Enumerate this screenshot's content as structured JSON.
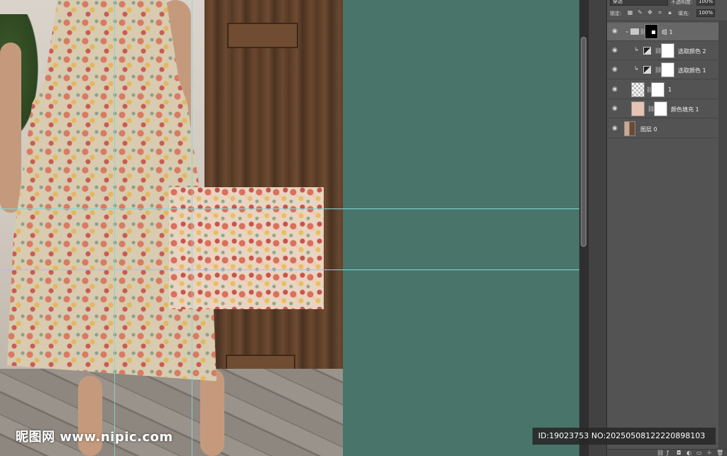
{
  "canvas": {
    "background_color": "#487469",
    "guide_color": "#7fd8d8",
    "watermark_left": "昵图网 www.nipic.com"
  },
  "layers_panel": {
    "blend_mode": "穿透",
    "opacity_label": "不透明度:",
    "opacity_value": "100%",
    "lock_label": "锁定:",
    "fill_label": "填充:",
    "fill_value": "100%",
    "layers": [
      {
        "name": "组 1",
        "type": "group",
        "selected": true,
        "thumb": "black"
      },
      {
        "name": "选取颜色 2",
        "type": "adjustment",
        "clipped": true,
        "thumb": "white"
      },
      {
        "name": "选取颜色 1",
        "type": "adjustment",
        "clipped": true,
        "thumb": "white"
      },
      {
        "name": "1",
        "type": "pattern",
        "thumb": "checker"
      },
      {
        "name": "颜色填充 1",
        "type": "fill",
        "thumb": "peach"
      },
      {
        "name": "图层 0",
        "type": "pixel",
        "thumb": "photo"
      }
    ]
  },
  "id_watermark": "ID:19023753 NO:20250508122220898103",
  "icons": {
    "eye": "eye-icon",
    "chain": "link-icon",
    "clip": "clipping-arrow-icon",
    "folder": "folder-icon"
  }
}
